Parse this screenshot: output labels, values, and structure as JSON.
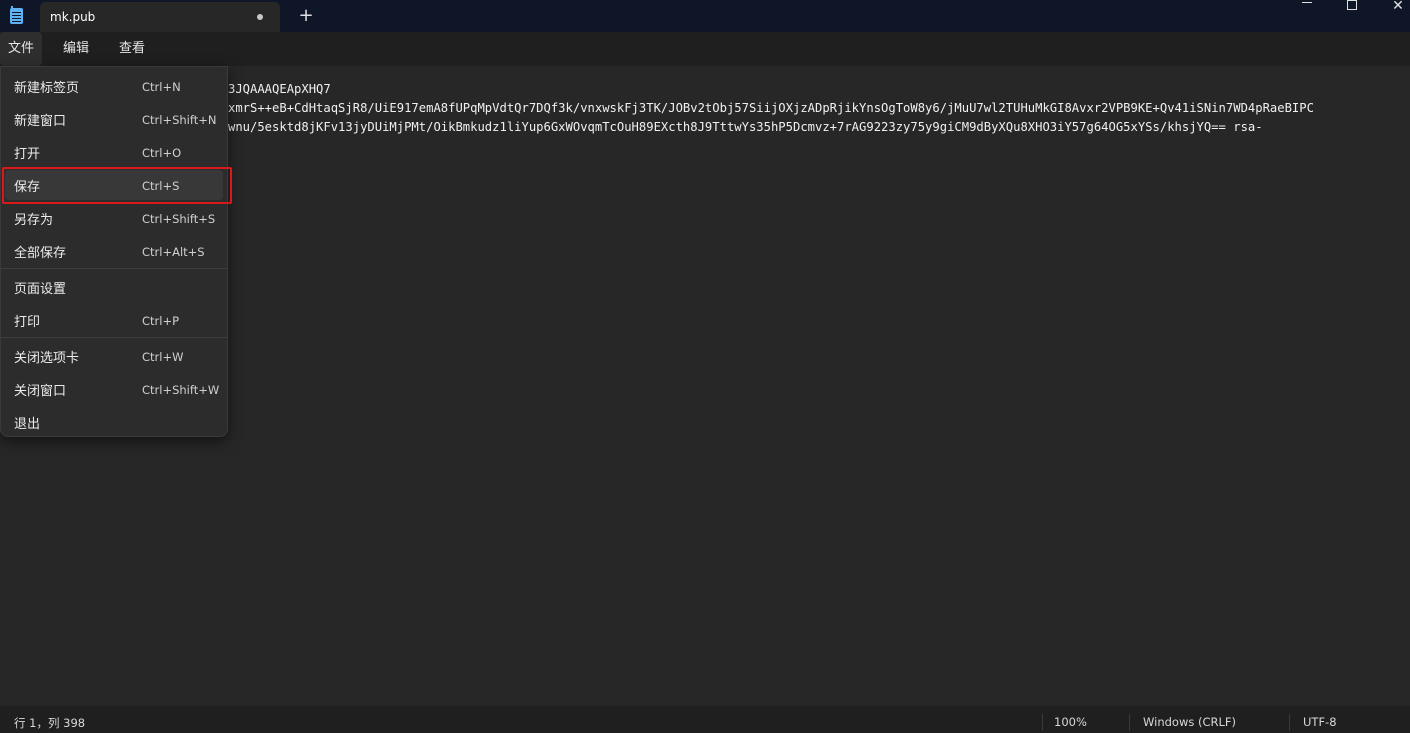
{
  "tab": {
    "title": "mk.pub",
    "new_tab_symbol": "+"
  },
  "window": {
    "close_symbol": "✕"
  },
  "menubar": {
    "file": "文件",
    "edit": "编辑",
    "view": "查看"
  },
  "editor": {
    "lines": [
      "3JQAAAQEApXHQ7",
      "xmrS++eB+CdHtaqSjR8/UiE917emA8fUPqMpVdtQr7DQf3k/vnxwskFj3TK/JOBv2tObj57SiijOXjzADpRjikYnsOgToW8y6/jMuU7wl2TUHuMkGI8Avxr2VPB9KE+Qv41iSNin7WD4pRaeBIPC",
      "wnu/5esktd8jKFv13jyDUiMjPMt/OikBmkudz1liYup6GxWOvqmTcOuH89EXcth8J9TttwYs35hP5Dcmvz+7rAG9223zy75y9giCM9dByXQu8XHO3iY57g64OG5xYSs/khsjYQ== rsa-"
    ]
  },
  "file_menu": {
    "items": [
      {
        "label": "新建标签页",
        "shortcut": "Ctrl+N"
      },
      {
        "label": "新建窗口",
        "shortcut": "Ctrl+Shift+N"
      },
      {
        "label": "打开",
        "shortcut": "Ctrl+O"
      },
      {
        "label": "保存",
        "shortcut": "Ctrl+S"
      },
      {
        "label": "另存为",
        "shortcut": "Ctrl+Shift+S"
      },
      {
        "label": "全部保存",
        "shortcut": "Ctrl+Alt+S"
      },
      {
        "label": "页面设置",
        "shortcut": ""
      },
      {
        "label": "打印",
        "shortcut": "Ctrl+P"
      },
      {
        "label": "关闭选项卡",
        "shortcut": "Ctrl+W"
      },
      {
        "label": "关闭窗口",
        "shortcut": "Ctrl+Shift+W"
      },
      {
        "label": "退出",
        "shortcut": ""
      }
    ],
    "highlighted_item": "保存",
    "highlight_color": "#d9191c"
  },
  "statusbar": {
    "position": "行 1，列 398",
    "zoom": "100%",
    "line_ending": "Windows (CRLF)",
    "encoding": "UTF-8"
  },
  "icons": {
    "app": "notepad-icon",
    "settings": "gear-icon"
  }
}
